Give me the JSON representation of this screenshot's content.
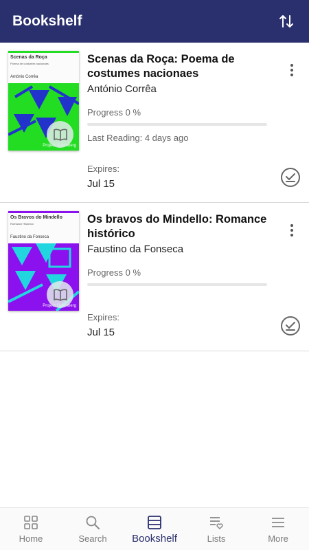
{
  "app_bar": {
    "title": "Bookshelf",
    "sort_icon": "sort-arrows-icon"
  },
  "books": [
    {
      "title": "Scenas da Roça: Poema de costumes nacionaes",
      "author": "António Corrêa",
      "progress_label": "Progress 0 %",
      "progress": 0,
      "last_reading": "Last Reading: 4 days ago",
      "expires_label": "Expires:",
      "expires_date": "Jul 15",
      "cover": {
        "title": "Scenas da Roça",
        "subtitle": "Poema de costumes nacionaes",
        "author": "António Corrêa",
        "publisher": "Project Gutenberg",
        "bg_color": "#22dd22",
        "shape_color": "#2233cc"
      }
    },
    {
      "title": "Os bravos do Mindello: Romance histórico",
      "author": "Faustino da Fonseca",
      "progress_label": "Progress 0 %",
      "progress": 0,
      "expires_label": "Expires:",
      "expires_date": "Jul 15",
      "cover": {
        "title": "Os Bravos do Mindello",
        "subtitle": "Romance Histórico",
        "author": "Faustino da Fonseca",
        "publisher": "Project Gutenberg",
        "bg_color": "#8b11ee",
        "shape_color": "#22d6e0"
      }
    }
  ],
  "bottom_nav": [
    {
      "label": "Home",
      "icon": "grid-icon",
      "active": false
    },
    {
      "label": "Search",
      "icon": "search-icon",
      "active": false
    },
    {
      "label": "Bookshelf",
      "icon": "bookshelf-icon",
      "active": true
    },
    {
      "label": "Lists",
      "icon": "list-heart-icon",
      "active": false
    },
    {
      "label": "More",
      "icon": "menu-icon",
      "active": false
    }
  ],
  "colors": {
    "primary": "#2a2f6e",
    "nav_inactive": "#7a7a7a"
  }
}
